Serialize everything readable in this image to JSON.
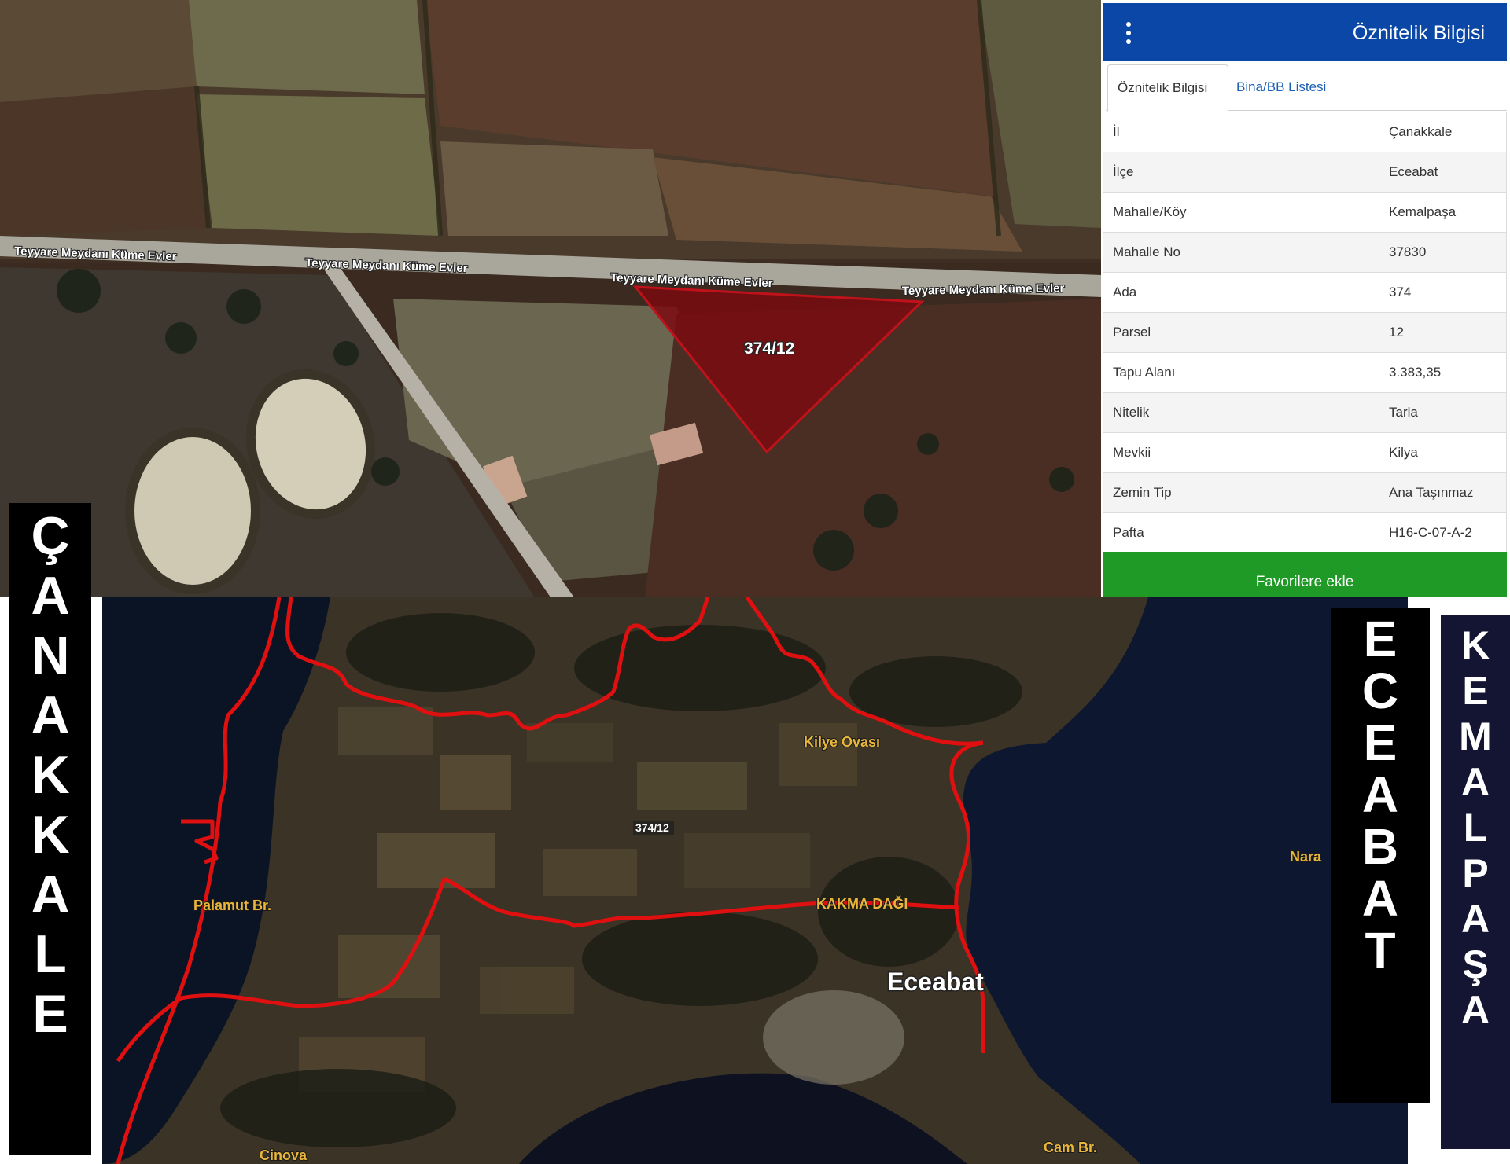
{
  "top_map": {
    "road_labels": [
      "Teyyare Meydanı Küme Evler",
      "Teyyare Meydanı Küme Evler",
      "Teyyare Meydanı Küme Evler",
      "Teyyare Meydanı Küme Evler"
    ],
    "parcel_label": "374/12",
    "parcel_color": "#7a0b10"
  },
  "panel": {
    "header_title": "Öznitelik Bilgisi",
    "header_color": "#0a47a6",
    "menu_icon": "vertical-dots-icon",
    "tabs": [
      "Öznitelik Bilgisi",
      "Bina/BB Listesi"
    ],
    "rows": [
      {
        "key": "İl",
        "value": "Çanakkale"
      },
      {
        "key": "İlçe",
        "value": "Eceabat"
      },
      {
        "key": "Mahalle/Köy",
        "value": "Kemalpaşa"
      },
      {
        "key": "Mahalle No",
        "value": "37830"
      },
      {
        "key": "Ada",
        "value": "374"
      },
      {
        "key": "Parsel",
        "value": "12"
      },
      {
        "key": "Tapu Alanı",
        "value": "3.383,35"
      },
      {
        "key": "Nitelik",
        "value": "Tarla"
      },
      {
        "key": "Mevkii",
        "value": "Kilya"
      },
      {
        "key": "Zemin Tip",
        "value": "Ana Taşınmaz"
      },
      {
        "key": "Pafta",
        "value": "H16-C-07-A-2"
      }
    ],
    "favorite_button": "Favorilere ekle",
    "favorite_color": "#1f9a27"
  },
  "bottom_map": {
    "places": {
      "kilye_ovasi": "Kilye Ovası",
      "palamut": "Palamut Br.",
      "kakma_dagi": "KAKMA DAĞI",
      "nara": "Nara",
      "cinova": "Cinova",
      "cam": "Cam Br.",
      "eceabat": "Eceabat"
    },
    "parcel_marker": "374/12",
    "boundary_color": "#e01010"
  },
  "banners": {
    "canakkale": "Ç\nA\nN\nA\nK\nK\nA\nL\nE",
    "eceabat": "E\nC\nE\nA\nB\nA\nT",
    "kemalpasa": "K\nE\nM\nA\nL\nP\nA\nŞ\nA"
  }
}
